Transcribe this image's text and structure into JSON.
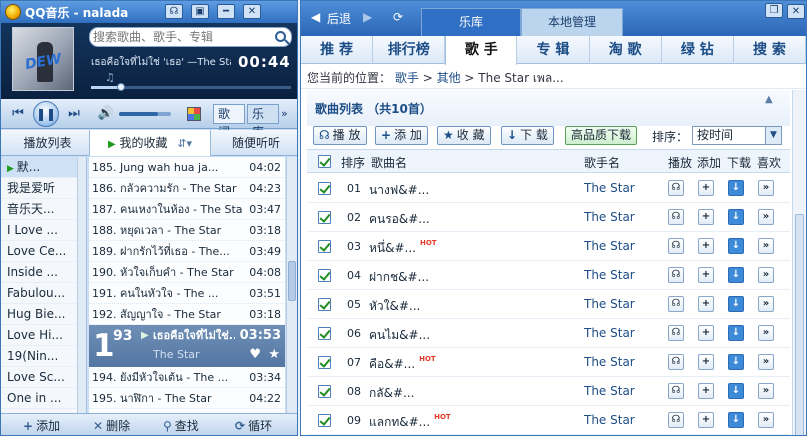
{
  "player": {
    "title": "QQ音乐 - nalada",
    "window_buttons": [
      "☊",
      "▣",
      "━",
      "✕"
    ],
    "search_placeholder": "搜索歌曲、歌手、专辑",
    "now_playing": {
      "track_line": "เธอคือใจที่ไม่ใช่ 'เธอ' —The Star",
      "time": "00:44",
      "progress": 0.15,
      "note": "♫",
      "album_text": "DEW"
    },
    "volume": 0.75,
    "mini_tabs": {
      "lyrics": "歌词",
      "library": "乐库",
      "more": "»"
    },
    "list_tabs": {
      "playlist": "播放列表",
      "favorites": "我的收藏",
      "random": "随便听听",
      "sort_icon": "⇵▾"
    },
    "playlists": [
      {
        "name": "默...",
        "active": true
      },
      {
        "name": "我是爱听",
        "active": false
      },
      {
        "name": "音乐天...",
        "active": false
      },
      {
        "name": "I Love ...",
        "active": false
      },
      {
        "name": "Love Ce...",
        "active": false
      },
      {
        "name": "Inside ...",
        "active": false
      },
      {
        "name": "Fabulou...",
        "active": false
      },
      {
        "name": "Hug Bie...",
        "active": false
      },
      {
        "name": "Love Hi...",
        "active": false
      },
      {
        "name": "19(Nin...",
        "active": false
      },
      {
        "name": "Love Sc...",
        "active": false
      },
      {
        "name": "One in ...",
        "active": false
      }
    ],
    "songs": [
      {
        "title": "185. Jung wah hua ja...",
        "duration": "04:02"
      },
      {
        "title": "186. กลัวความรัก - The Star",
        "duration": "04:23"
      },
      {
        "title": "187. คนเหงาในห้อง - The Star",
        "duration": "03:47"
      },
      {
        "title": "188. หยุดเวลา - The Star",
        "duration": "03:18"
      },
      {
        "title": "189. ฝากรักไว้ที่เธอ - The...",
        "duration": "03:49"
      },
      {
        "title": "190. หัวใจเก็บคำ - The Star",
        "duration": "04:08"
      },
      {
        "title": "191. คนในหัวใจ - The ...",
        "duration": "03:51"
      },
      {
        "title": "192. สัญญาใจ - The Star",
        "duration": "03:18"
      }
    ],
    "current_song": {
      "num_big": "1",
      "num_small": "93",
      "title": "เธอคือใจที่ไม่ใช่...",
      "artist": "The Star",
      "duration": "03:53"
    },
    "songs_after": [
      {
        "title": "194. ยังมีหัวใจเต้น - The ...",
        "duration": "03:34"
      },
      {
        "title": "195. นาฬิกา - The Star",
        "duration": "04:22"
      }
    ],
    "footer": {
      "add": "添加",
      "delete": "删除",
      "find": "查找",
      "loop": "循环"
    }
  },
  "library": {
    "nav": {
      "back": "后退"
    },
    "top_tabs": {
      "library": "乐库",
      "local": "本地管理"
    },
    "categories": [
      "推 荐",
      "排行榜",
      "歌 手",
      "专 辑",
      "淘 歌",
      "绿 钻",
      "搜 索"
    ],
    "active_category": 2,
    "breadcrumb": {
      "prefix": "您当前的位置：",
      "items": [
        "歌手",
        "其他",
        "The Star เพล..."
      ]
    },
    "list_title": "歌曲列表 （共10首）",
    "toolbar": {
      "play": "播 放",
      "add": "添 加",
      "fav": "收 藏",
      "download": "下 载",
      "hq": "高品质下载",
      "sort_label": "排序：",
      "sort_value": "按时间"
    },
    "columns": {
      "index": "排序",
      "name": "歌曲名",
      "artist": "歌手名",
      "play": "播放",
      "add": "添加",
      "download": "下载",
      "like": "喜欢"
    },
    "rows": [
      {
        "num": "01",
        "name": "นางฟ&#...",
        "hot": "",
        "artist": "The Star"
      },
      {
        "num": "02",
        "name": "คนรอ&#...",
        "hot": "",
        "artist": "The Star"
      },
      {
        "num": "03",
        "name": "หนึ่&#...",
        "hot": "HOT",
        "artist": "The Star"
      },
      {
        "num": "04",
        "name": "ฝากช&#...",
        "hot": "",
        "artist": "The Star"
      },
      {
        "num": "05",
        "name": "หัวใ&#...",
        "hot": "",
        "artist": "The Star"
      },
      {
        "num": "06",
        "name": "คนไม&#...",
        "hot": "",
        "artist": "The Star"
      },
      {
        "num": "07",
        "name": "คือ&#...",
        "hot": "HOT",
        "artist": "The Star"
      },
      {
        "num": "08",
        "name": "กลั&#...",
        "hot": "",
        "artist": "The Star"
      },
      {
        "num": "09",
        "name": "แลกท&#...",
        "hot": "HOT",
        "artist": "The Star"
      }
    ]
  }
}
